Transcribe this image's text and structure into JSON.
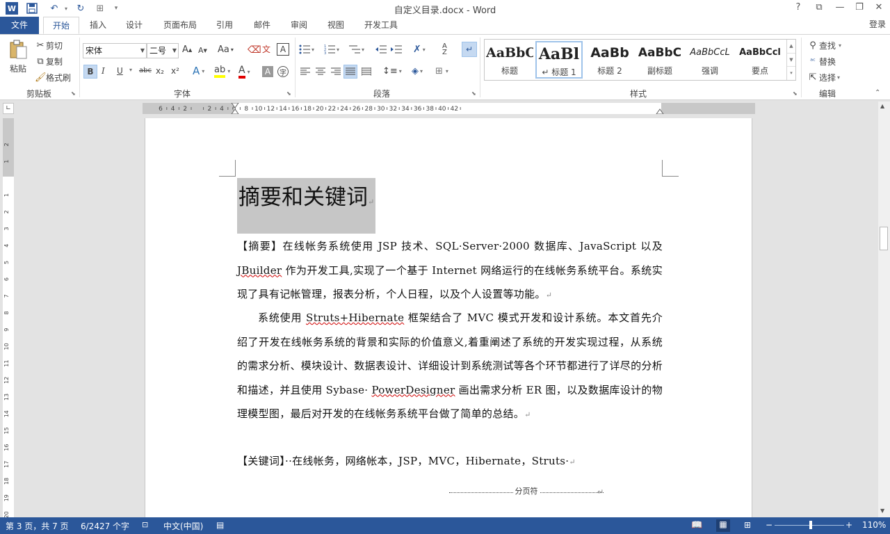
{
  "window": {
    "title": "自定义目录.docx - Word",
    "help": "?",
    "restore_ribbon": "⧉",
    "minimize": "—",
    "maximize": "🗗",
    "close": "✕",
    "signin": "登录"
  },
  "quick_access": {
    "word_icon": "W",
    "save_icon": "💾",
    "undo_icon": "↶",
    "redo_icon": "↻",
    "touch_icon": "⊞",
    "more_icon": "▾"
  },
  "tabs": [
    "文件",
    "开始",
    "插入",
    "设计",
    "页面布局",
    "引用",
    "邮件",
    "审阅",
    "视图",
    "开发工具"
  ],
  "clipboard": {
    "paste": "粘贴",
    "cut": "剪切",
    "copy": "复制",
    "format_painter": "格式刷",
    "label": "剪贴板"
  },
  "font": {
    "name": "宋体",
    "size": "二号",
    "grow": "A",
    "shrink": "A",
    "case": "Aa",
    "bold": "B",
    "italic": "I",
    "underline": "U",
    "strike": "abc",
    "subscript": "x₂",
    "superscript": "x²",
    "label": "字体"
  },
  "paragraph": {
    "label": "段落"
  },
  "styles": {
    "items": [
      {
        "sample": "AaBbC",
        "name": "标题"
      },
      {
        "sample": "AaBl",
        "name": "↵ 标题 1"
      },
      {
        "sample": "AaBb",
        "name": "标题 2"
      },
      {
        "sample": "AaBbC",
        "name": "副标题"
      },
      {
        "sample": "AaBbCcL",
        "name": "强调"
      },
      {
        "sample": "AaBbCcl",
        "name": "要点"
      }
    ],
    "label": "样式"
  },
  "editing": {
    "find": "查找",
    "replace": "替换",
    "select": "选择",
    "label": "编辑"
  },
  "ruler": {
    "ticks": [
      "6",
      "4",
      "2",
      "",
      "2",
      "4",
      "6",
      "8",
      "10",
      "12",
      "14",
      "16",
      "18",
      "20",
      "22",
      "24",
      "26",
      "28",
      "30",
      "32",
      "34",
      "36",
      "38",
      "40",
      "42"
    ],
    "vticks": [
      "2",
      "1",
      "",
      "1",
      "2",
      "3",
      "4",
      "5",
      "6",
      "7",
      "8",
      "9",
      "10",
      "11",
      "12",
      "13",
      "14",
      "15",
      "16",
      "17",
      "18",
      "19",
      "20"
    ]
  },
  "document": {
    "heading": "摘要和关键词",
    "p1": [
      {
        "t": "【摘要】在线帐务系统使用 JSP 技术、SQL·Server·2000 数据库、JavaScript 以及"
      },
      {
        "t": "JBuilder",
        "sq": true
      },
      {
        "t": " 作为开发工具,实现了一个基于 Internet 网络运行的在线帐务系统平台。系统实现了具有记帐管理，报表分析，个人日程，以及个人设置等功能。"
      }
    ],
    "p2": [
      {
        "t": "系统使用 "
      },
      {
        "t": "Struts+Hibernate",
        "sq": true
      },
      {
        "t": " 框架结合了 MVC 模式开发和设计系统。本文首先介绍了开发在线帐务系统的背景和实际的价值意义,着重阐述了系统的开发实现过程，从系统的需求分析、模块设计、数据表设计、详细设计到系统测试等各个环节都进行了详尽的分析和描述，并且使用 Sybase· "
      },
      {
        "t": "PowerDesigner",
        "sq": true
      },
      {
        "t": " 画出需求分析 ER 图，以及数据库设计的物理模型图，最后对开发的在线帐务系统平台做了简单的总结。"
      }
    ],
    "p3": "【关键词】··在线帐务，网络帐本，JSP，MVC，Hibernate，Struts·",
    "pilcrow": "↵",
    "page_break": "分页符"
  },
  "status": {
    "page": "第 3 页，共 7 页",
    "words": "6/2427 个字",
    "language": "中文(中国)",
    "zoom": "110%",
    "zoom_fraction": 0.52
  }
}
